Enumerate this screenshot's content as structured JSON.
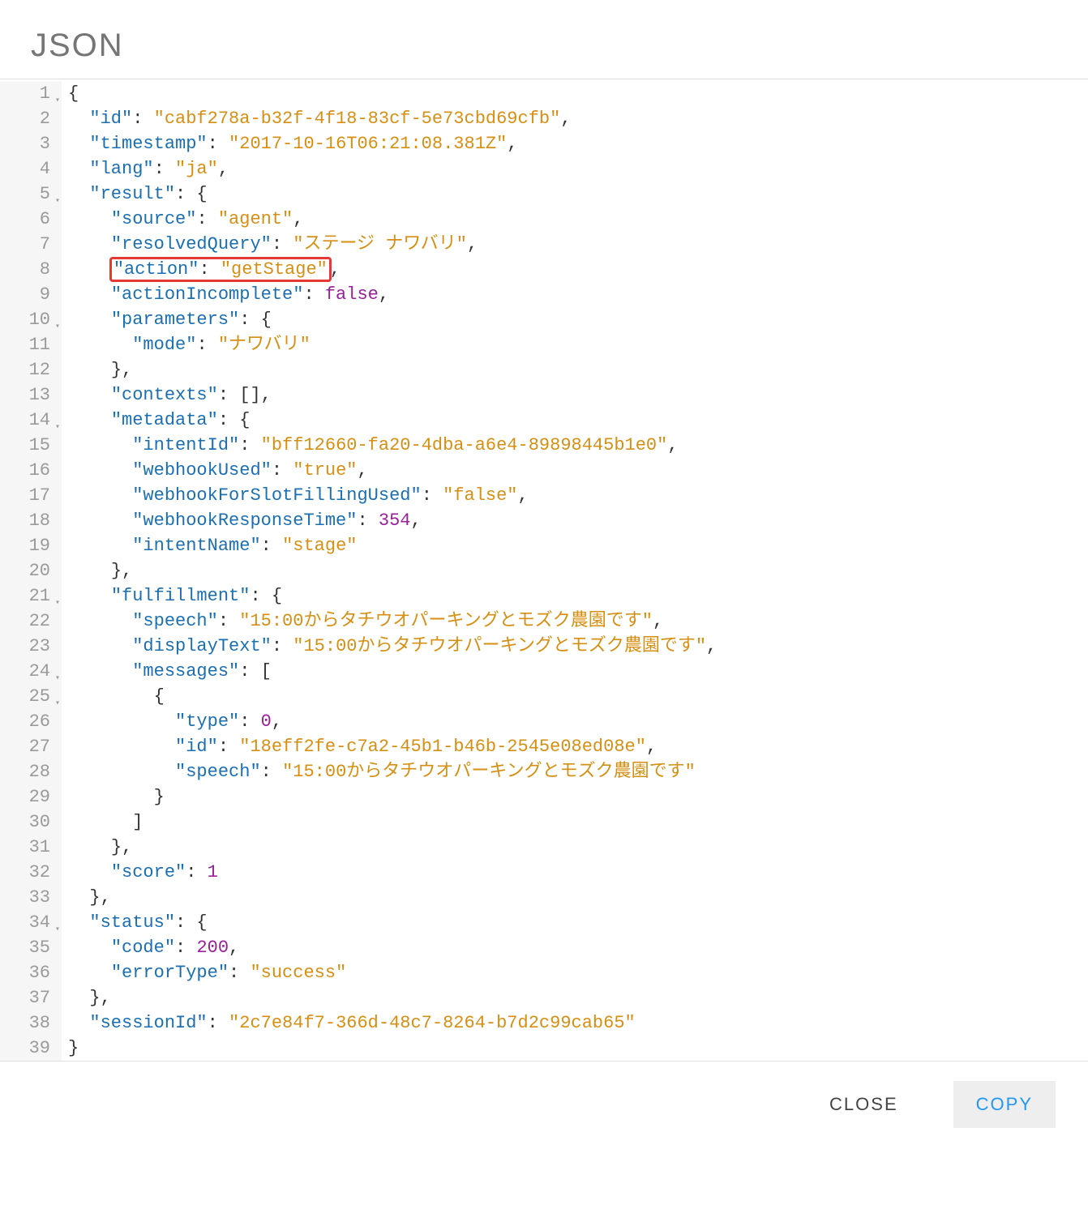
{
  "title": "JSON",
  "footer": {
    "close_label": "CLOSE",
    "copy_label": "COPY"
  },
  "highlight_line": 8,
  "fold_lines": [
    1,
    5,
    10,
    14,
    21,
    24,
    25,
    34
  ],
  "code": {
    "lines": [
      {
        "n": 1,
        "indent": 0,
        "tokens": [
          {
            "t": "p",
            "v": "{"
          }
        ]
      },
      {
        "n": 2,
        "indent": 1,
        "tokens": [
          {
            "t": "k",
            "v": "\"id\""
          },
          {
            "t": "p",
            "v": ": "
          },
          {
            "t": "s",
            "v": "\"cabf278a-b32f-4f18-83cf-5e73cbd69cfb\""
          },
          {
            "t": "p",
            "v": ","
          }
        ]
      },
      {
        "n": 3,
        "indent": 1,
        "tokens": [
          {
            "t": "k",
            "v": "\"timestamp\""
          },
          {
            "t": "p",
            "v": ": "
          },
          {
            "t": "s",
            "v": "\"2017-10-16T06:21:08.381Z\""
          },
          {
            "t": "p",
            "v": ","
          }
        ]
      },
      {
        "n": 4,
        "indent": 1,
        "tokens": [
          {
            "t": "k",
            "v": "\"lang\""
          },
          {
            "t": "p",
            "v": ": "
          },
          {
            "t": "s",
            "v": "\"ja\""
          },
          {
            "t": "p",
            "v": ","
          }
        ]
      },
      {
        "n": 5,
        "indent": 1,
        "tokens": [
          {
            "t": "k",
            "v": "\"result\""
          },
          {
            "t": "p",
            "v": ": {"
          }
        ]
      },
      {
        "n": 6,
        "indent": 2,
        "tokens": [
          {
            "t": "k",
            "v": "\"source\""
          },
          {
            "t": "p",
            "v": ": "
          },
          {
            "t": "s",
            "v": "\"agent\""
          },
          {
            "t": "p",
            "v": ","
          }
        ]
      },
      {
        "n": 7,
        "indent": 2,
        "tokens": [
          {
            "t": "k",
            "v": "\"resolvedQuery\""
          },
          {
            "t": "p",
            "v": ": "
          },
          {
            "t": "s",
            "v": "\"ステージ ナワバリ\""
          },
          {
            "t": "p",
            "v": ","
          }
        ]
      },
      {
        "n": 8,
        "indent": 2,
        "tokens": [
          {
            "t": "k",
            "v": "\"action\""
          },
          {
            "t": "p",
            "v": ": "
          },
          {
            "t": "s",
            "v": "\"getStage\""
          },
          {
            "t": "p",
            "v": ","
          }
        ]
      },
      {
        "n": 9,
        "indent": 2,
        "tokens": [
          {
            "t": "k",
            "v": "\"actionIncomplete\""
          },
          {
            "t": "p",
            "v": ": "
          },
          {
            "t": "b",
            "v": "false"
          },
          {
            "t": "p",
            "v": ","
          }
        ]
      },
      {
        "n": 10,
        "indent": 2,
        "tokens": [
          {
            "t": "k",
            "v": "\"parameters\""
          },
          {
            "t": "p",
            "v": ": {"
          }
        ]
      },
      {
        "n": 11,
        "indent": 3,
        "tokens": [
          {
            "t": "k",
            "v": "\"mode\""
          },
          {
            "t": "p",
            "v": ": "
          },
          {
            "t": "s",
            "v": "\"ナワバリ\""
          }
        ]
      },
      {
        "n": 12,
        "indent": 2,
        "tokens": [
          {
            "t": "p",
            "v": "},"
          }
        ]
      },
      {
        "n": 13,
        "indent": 2,
        "tokens": [
          {
            "t": "k",
            "v": "\"contexts\""
          },
          {
            "t": "p",
            "v": ": [],"
          }
        ]
      },
      {
        "n": 14,
        "indent": 2,
        "tokens": [
          {
            "t": "k",
            "v": "\"metadata\""
          },
          {
            "t": "p",
            "v": ": {"
          }
        ]
      },
      {
        "n": 15,
        "indent": 3,
        "tokens": [
          {
            "t": "k",
            "v": "\"intentId\""
          },
          {
            "t": "p",
            "v": ": "
          },
          {
            "t": "s",
            "v": "\"bff12660-fa20-4dba-a6e4-89898445b1e0\""
          },
          {
            "t": "p",
            "v": ","
          }
        ]
      },
      {
        "n": 16,
        "indent": 3,
        "tokens": [
          {
            "t": "k",
            "v": "\"webhookUsed\""
          },
          {
            "t": "p",
            "v": ": "
          },
          {
            "t": "s",
            "v": "\"true\""
          },
          {
            "t": "p",
            "v": ","
          }
        ]
      },
      {
        "n": 17,
        "indent": 3,
        "tokens": [
          {
            "t": "k",
            "v": "\"webhookForSlotFillingUsed\""
          },
          {
            "t": "p",
            "v": ": "
          },
          {
            "t": "s",
            "v": "\"false\""
          },
          {
            "t": "p",
            "v": ","
          }
        ]
      },
      {
        "n": 18,
        "indent": 3,
        "tokens": [
          {
            "t": "k",
            "v": "\"webhookResponseTime\""
          },
          {
            "t": "p",
            "v": ": "
          },
          {
            "t": "n",
            "v": "354"
          },
          {
            "t": "p",
            "v": ","
          }
        ]
      },
      {
        "n": 19,
        "indent": 3,
        "tokens": [
          {
            "t": "k",
            "v": "\"intentName\""
          },
          {
            "t": "p",
            "v": ": "
          },
          {
            "t": "s",
            "v": "\"stage\""
          }
        ]
      },
      {
        "n": 20,
        "indent": 2,
        "tokens": [
          {
            "t": "p",
            "v": "},"
          }
        ]
      },
      {
        "n": 21,
        "indent": 2,
        "tokens": [
          {
            "t": "k",
            "v": "\"fulfillment\""
          },
          {
            "t": "p",
            "v": ": {"
          }
        ]
      },
      {
        "n": 22,
        "indent": 3,
        "tokens": [
          {
            "t": "k",
            "v": "\"speech\""
          },
          {
            "t": "p",
            "v": ": "
          },
          {
            "t": "s",
            "v": "\"15:00からタチウオパーキングとモズク農園です\""
          },
          {
            "t": "p",
            "v": ","
          }
        ]
      },
      {
        "n": 23,
        "indent": 3,
        "tokens": [
          {
            "t": "k",
            "v": "\"displayText\""
          },
          {
            "t": "p",
            "v": ": "
          },
          {
            "t": "s",
            "v": "\"15:00からタチウオパーキングとモズク農園です\""
          },
          {
            "t": "p",
            "v": ","
          }
        ]
      },
      {
        "n": 24,
        "indent": 3,
        "tokens": [
          {
            "t": "k",
            "v": "\"messages\""
          },
          {
            "t": "p",
            "v": ": ["
          }
        ]
      },
      {
        "n": 25,
        "indent": 4,
        "tokens": [
          {
            "t": "p",
            "v": "{"
          }
        ]
      },
      {
        "n": 26,
        "indent": 5,
        "tokens": [
          {
            "t": "k",
            "v": "\"type\""
          },
          {
            "t": "p",
            "v": ": "
          },
          {
            "t": "n",
            "v": "0"
          },
          {
            "t": "p",
            "v": ","
          }
        ]
      },
      {
        "n": 27,
        "indent": 5,
        "tokens": [
          {
            "t": "k",
            "v": "\"id\""
          },
          {
            "t": "p",
            "v": ": "
          },
          {
            "t": "s",
            "v": "\"18eff2fe-c7a2-45b1-b46b-2545e08ed08e\""
          },
          {
            "t": "p",
            "v": ","
          }
        ]
      },
      {
        "n": 28,
        "indent": 5,
        "tokens": [
          {
            "t": "k",
            "v": "\"speech\""
          },
          {
            "t": "p",
            "v": ": "
          },
          {
            "t": "s",
            "v": "\"15:00からタチウオパーキングとモズク農園です\""
          }
        ]
      },
      {
        "n": 29,
        "indent": 4,
        "tokens": [
          {
            "t": "p",
            "v": "}"
          }
        ]
      },
      {
        "n": 30,
        "indent": 3,
        "tokens": [
          {
            "t": "p",
            "v": "]"
          }
        ]
      },
      {
        "n": 31,
        "indent": 2,
        "tokens": [
          {
            "t": "p",
            "v": "},"
          }
        ]
      },
      {
        "n": 32,
        "indent": 2,
        "tokens": [
          {
            "t": "k",
            "v": "\"score\""
          },
          {
            "t": "p",
            "v": ": "
          },
          {
            "t": "n",
            "v": "1"
          }
        ]
      },
      {
        "n": 33,
        "indent": 1,
        "tokens": [
          {
            "t": "p",
            "v": "},"
          }
        ]
      },
      {
        "n": 34,
        "indent": 1,
        "tokens": [
          {
            "t": "k",
            "v": "\"status\""
          },
          {
            "t": "p",
            "v": ": {"
          }
        ]
      },
      {
        "n": 35,
        "indent": 2,
        "tokens": [
          {
            "t": "k",
            "v": "\"code\""
          },
          {
            "t": "p",
            "v": ": "
          },
          {
            "t": "n",
            "v": "200"
          },
          {
            "t": "p",
            "v": ","
          }
        ]
      },
      {
        "n": 36,
        "indent": 2,
        "tokens": [
          {
            "t": "k",
            "v": "\"errorType\""
          },
          {
            "t": "p",
            "v": ": "
          },
          {
            "t": "s",
            "v": "\"success\""
          }
        ]
      },
      {
        "n": 37,
        "indent": 1,
        "tokens": [
          {
            "t": "p",
            "v": "},"
          }
        ]
      },
      {
        "n": 38,
        "indent": 1,
        "tokens": [
          {
            "t": "k",
            "v": "\"sessionId\""
          },
          {
            "t": "p",
            "v": ": "
          },
          {
            "t": "s",
            "v": "\"2c7e84f7-366d-48c7-8264-b7d2c99cab65\""
          }
        ]
      },
      {
        "n": 39,
        "indent": 0,
        "tokens": [
          {
            "t": "p",
            "v": "}"
          }
        ]
      }
    ]
  }
}
